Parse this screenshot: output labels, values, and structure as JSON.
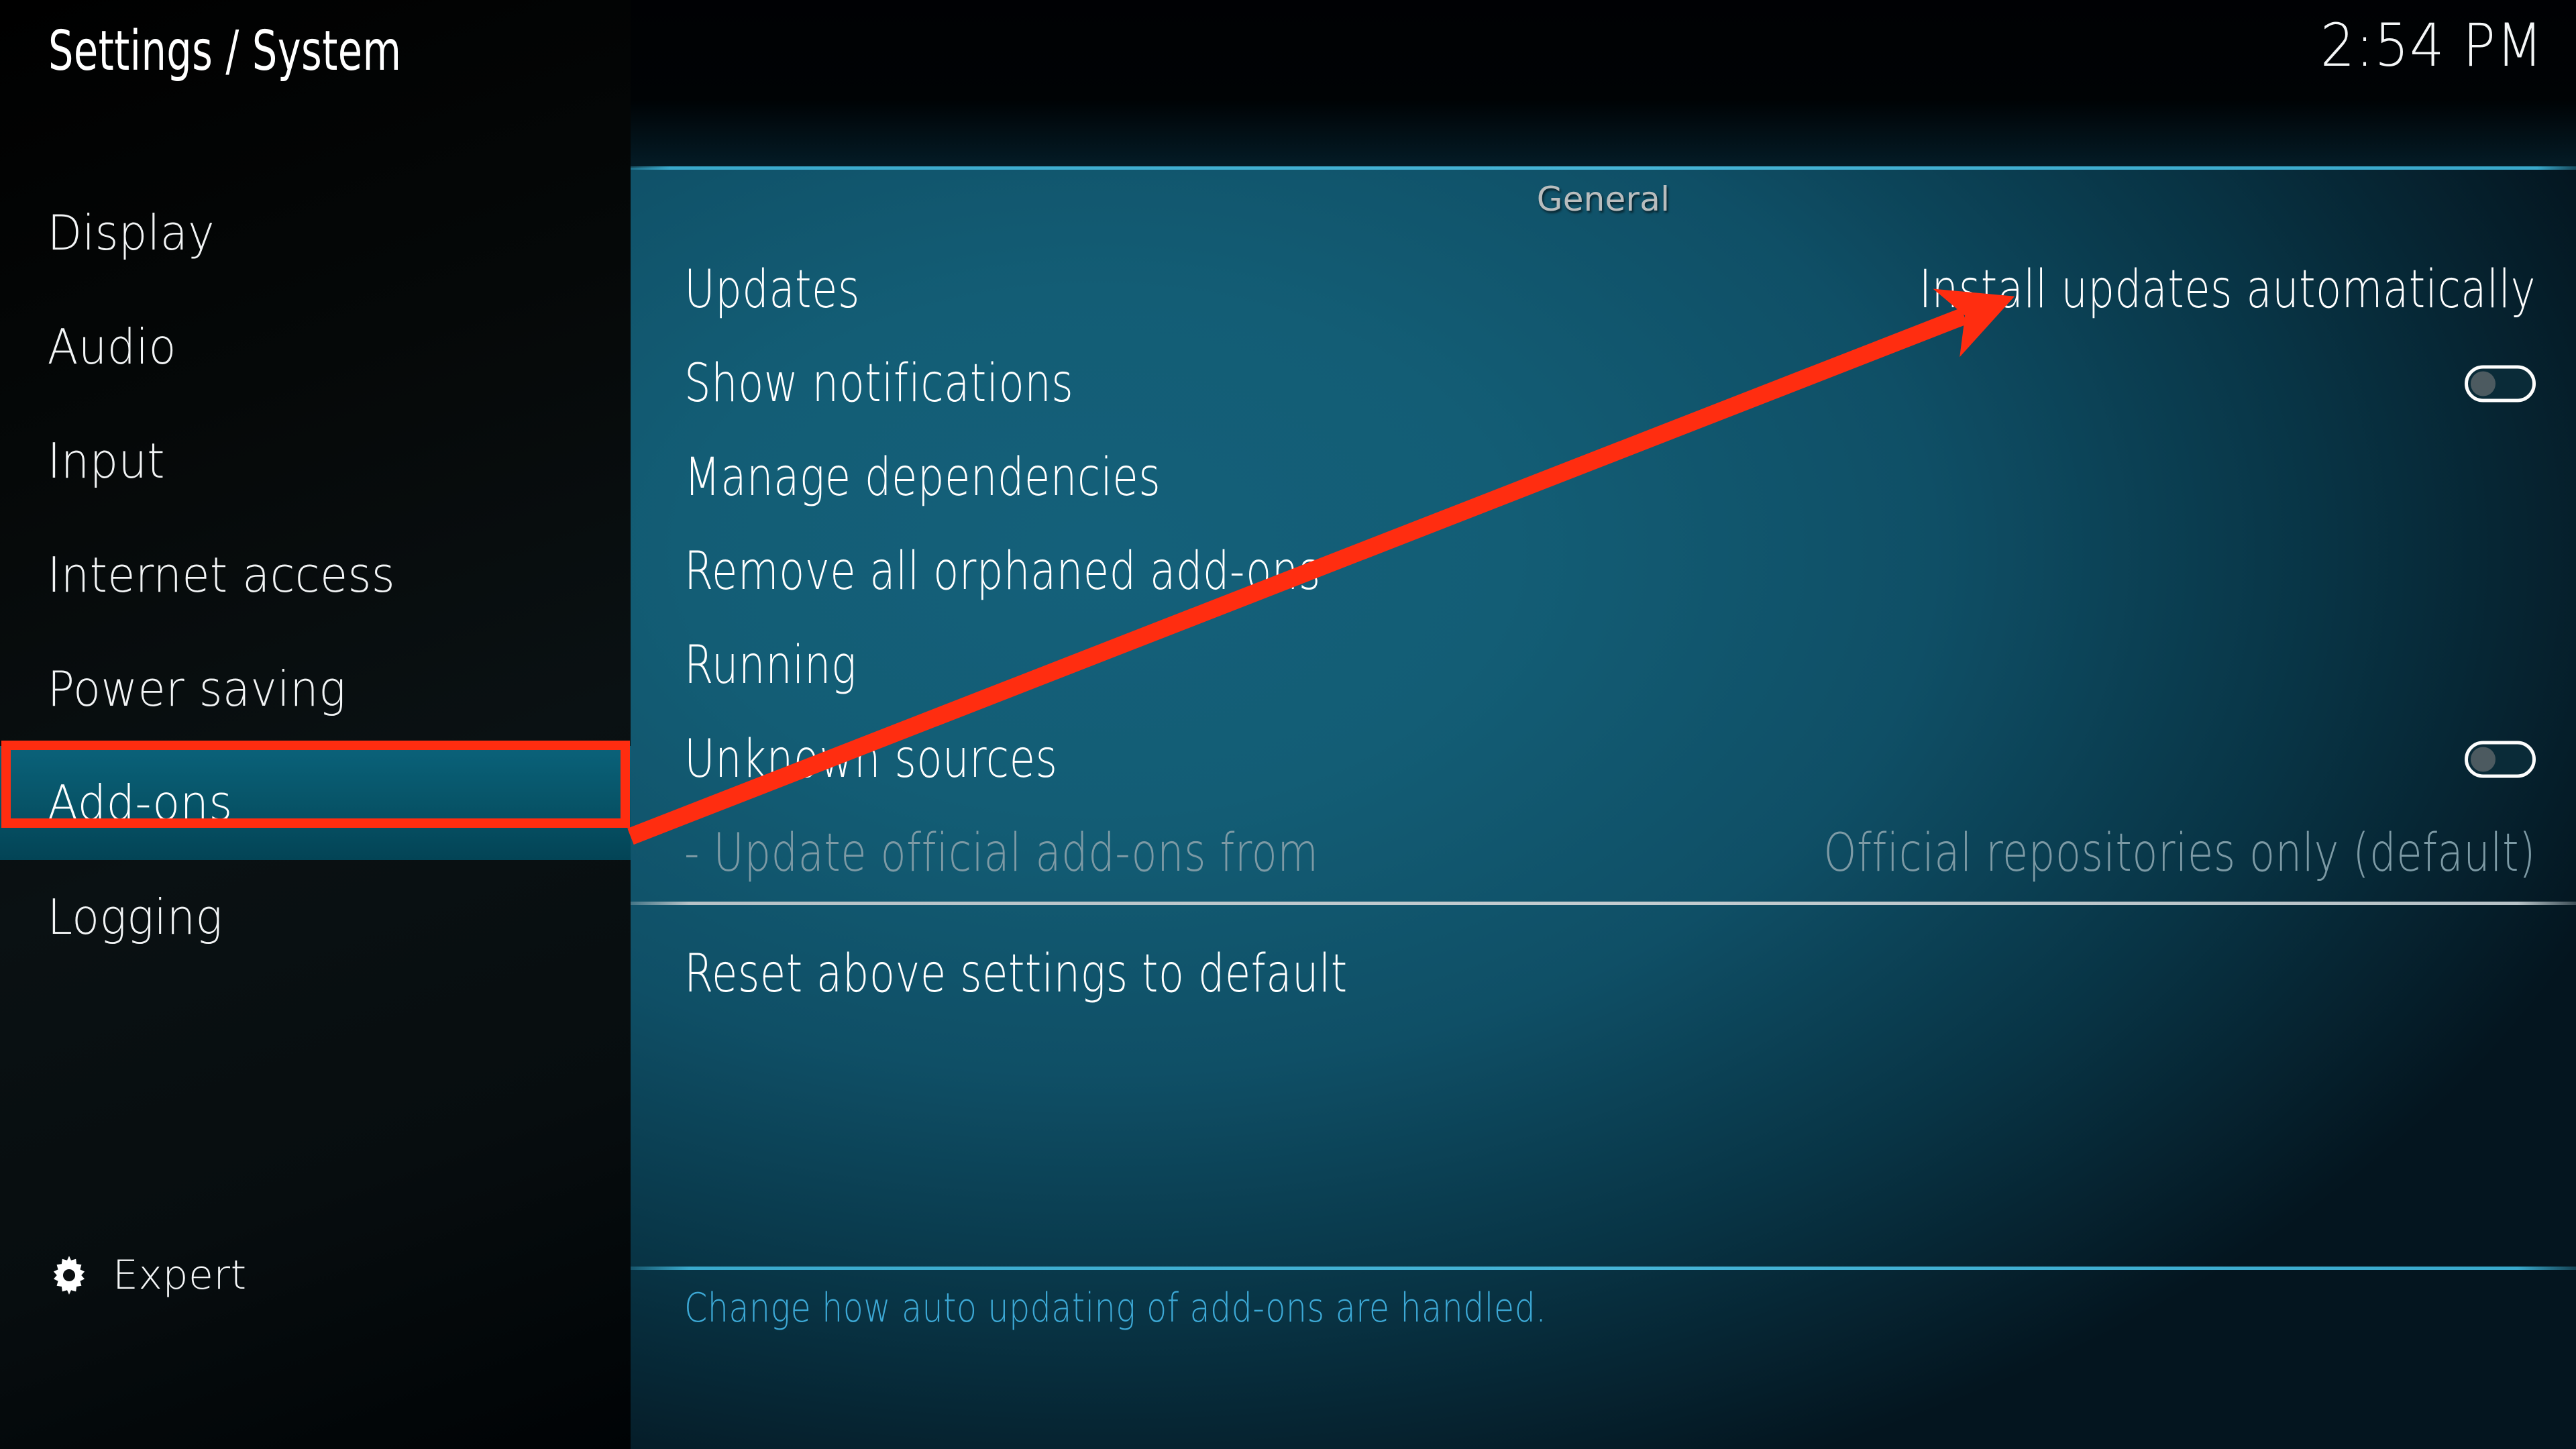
{
  "header": {
    "title": "Settings / System",
    "clock": "2:54 PM"
  },
  "sidebar": {
    "items": [
      {
        "label": "Display",
        "selected": false
      },
      {
        "label": "Audio",
        "selected": false
      },
      {
        "label": "Input",
        "selected": false
      },
      {
        "label": "Internet access",
        "selected": false
      },
      {
        "label": "Power saving",
        "selected": false
      },
      {
        "label": "Add-ons",
        "selected": true
      },
      {
        "label": "Logging",
        "selected": false
      }
    ],
    "level_button": {
      "label": "Expert",
      "icon": "gear-icon"
    }
  },
  "main": {
    "section_title": "General",
    "rows": [
      {
        "label": "Updates",
        "value": "Install updates automatically",
        "control": "value",
        "disabled": false
      },
      {
        "label": "Show notifications",
        "value": "",
        "control": "toggle",
        "toggle_on": false,
        "disabled": false
      },
      {
        "label": "Manage dependencies",
        "value": "",
        "control": "none",
        "disabled": false
      },
      {
        "label": "Remove all orphaned add-ons",
        "value": "",
        "control": "none",
        "disabled": false
      },
      {
        "label": "Running",
        "value": "",
        "control": "none",
        "disabled": false
      },
      {
        "label": "Unknown sources",
        "value": "",
        "control": "toggle",
        "toggle_on": false,
        "disabled": false
      },
      {
        "label": "- Update official add-ons from",
        "value": "Official repositories only (default)",
        "control": "value",
        "disabled": true
      }
    ],
    "reset_row": {
      "label": "Reset above settings to default"
    },
    "help_text": "Change how auto updating of add-ons are handled."
  },
  "annotation": {
    "highlight_target": "Add-ons",
    "arrow_points_to": "Install updates automatically",
    "color": "#ff2d10"
  },
  "colors": {
    "accent_cyan": "#3aa9cc",
    "panel_teal": "#14607a",
    "selected_teal": "#075468",
    "annotation_red": "#ff2d10",
    "help_blue": "#3da9d6",
    "disabled_text": "#7d9aa5"
  }
}
